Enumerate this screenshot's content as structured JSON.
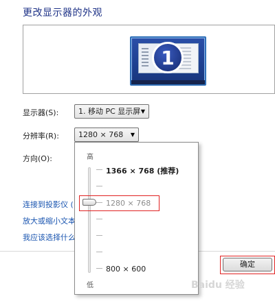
{
  "page": {
    "title": "更改显示器的外观"
  },
  "preview": {
    "display_number": "1"
  },
  "display_row": {
    "label": "显示器(S):",
    "value": "1. 移动 PC 显示屏"
  },
  "resolution_row": {
    "label": "分辨率(R):",
    "value": "1280 × 768"
  },
  "orientation_row": {
    "label": "方向(O):"
  },
  "resolution_dropdown": {
    "high_label": "高",
    "low_label": "低",
    "options": [
      {
        "label": "1366 × 768 (推荐)"
      },
      {
        "label": "1280 × 768"
      },
      {
        "label": "800 × 600"
      }
    ],
    "selected": "1280 × 768"
  },
  "links": [
    {
      "label": "连接到投影仪 ("
    },
    {
      "label": "放大或缩小文本"
    },
    {
      "label": "我应该选择什么"
    }
  ],
  "buttons": {
    "ok": "确定"
  },
  "colors": {
    "highlight_red": "#e02020",
    "title_blue": "#1e3287",
    "link_blue": "#1a55b0"
  },
  "watermark": "Baidu 经验"
}
